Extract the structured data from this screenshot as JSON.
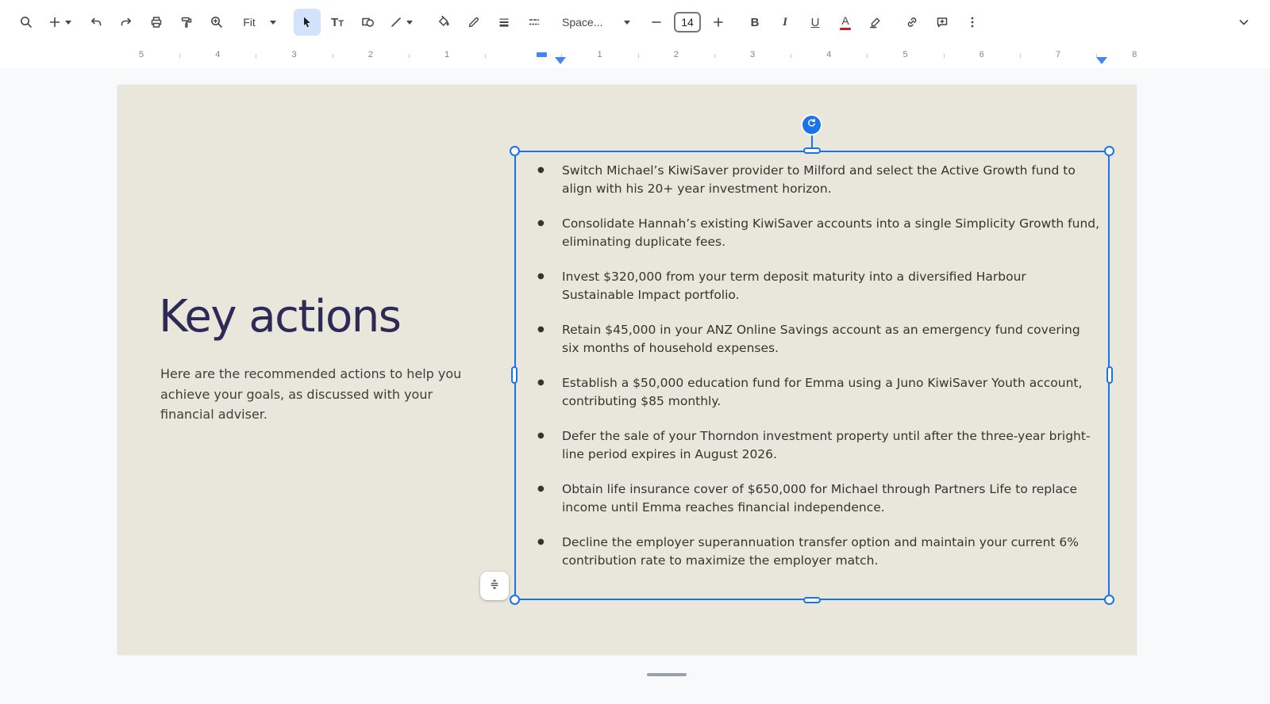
{
  "toolbar": {
    "zoom_label": "Fit",
    "font_label": "Space...",
    "font_size": "14",
    "bold": "B",
    "italic": "I",
    "underline": "U",
    "text_color_letter": "A",
    "text_tool_big": "T",
    "text_tool_small": "T"
  },
  "ruler": {
    "numbers": [
      "5",
      "4",
      "3",
      "2",
      "1",
      "",
      "1",
      "2",
      "3",
      "4",
      "5",
      "6",
      "7",
      "8"
    ]
  },
  "slide": {
    "title": "Key actions",
    "subtitle": "Here are the recommended actions to help you achieve your goals, as discussed with your financial adviser.",
    "bullets": [
      "Switch Michael’s KiwiSaver provider to Milford and select the Active Growth fund to align with his 20+ year investment horizon.",
      "Consolidate Hannah’s existing KiwiSaver accounts into a single Simplicity Growth fund, eliminating duplicate fees.",
      "Invest $320,000 from your term deposit maturity into a diversified Harbour Sustainable Impact portfolio.",
      "Retain $45,000 in your ANZ Online Savings account as an emergency fund covering six months of household expenses.",
      "Establish a $50,000 education fund for Emma using a Juno KiwiSaver Youth account, contributing $85 monthly.",
      "Defer the sale of your Thorndon investment property until after the three-year bright-line period expires in August 2026.",
      "Obtain life insurance cover of $650,000 for Michael through Partners Life to replace income until Emma reaches financial independence.",
      "Decline the employer superannuation transfer option and maintain your current 6% contribution rate to maximize the employer match."
    ]
  },
  "colors": {
    "selection_blue": "#1a73e8",
    "ruler_marker_blue": "#4285f4",
    "slide_background": "#e9e7dc",
    "title_color": "#2d2a55"
  }
}
